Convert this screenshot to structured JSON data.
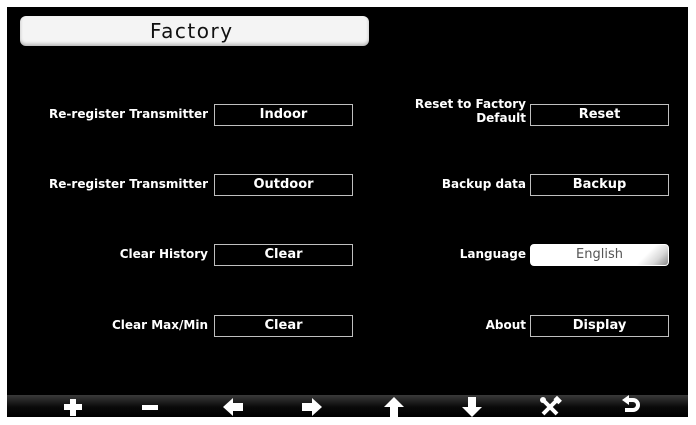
{
  "title": "Factory",
  "left_rows": [
    {
      "label": "Re-register Transmitter",
      "button": "Indoor"
    },
    {
      "label": "Re-register Transmitter",
      "button": "Outdoor"
    },
    {
      "label": "Clear History",
      "button": "Clear"
    },
    {
      "label": "Clear Max/Min",
      "button": "Clear"
    }
  ],
  "right_rows": {
    "reset": {
      "label_line1": "Reset to Factory",
      "label_line2": "Default",
      "button": "Reset"
    },
    "backup": {
      "label": "Backup data",
      "button": "Backup"
    },
    "language": {
      "label": "Language",
      "value": "English"
    },
    "about": {
      "label": "About",
      "button": "Display"
    }
  },
  "toolbar": [
    "plus-icon",
    "minus-icon",
    "arrow-left-icon",
    "arrow-right-icon",
    "arrow-up-icon",
    "arrow-down-icon",
    "tools-icon",
    "back-icon"
  ]
}
